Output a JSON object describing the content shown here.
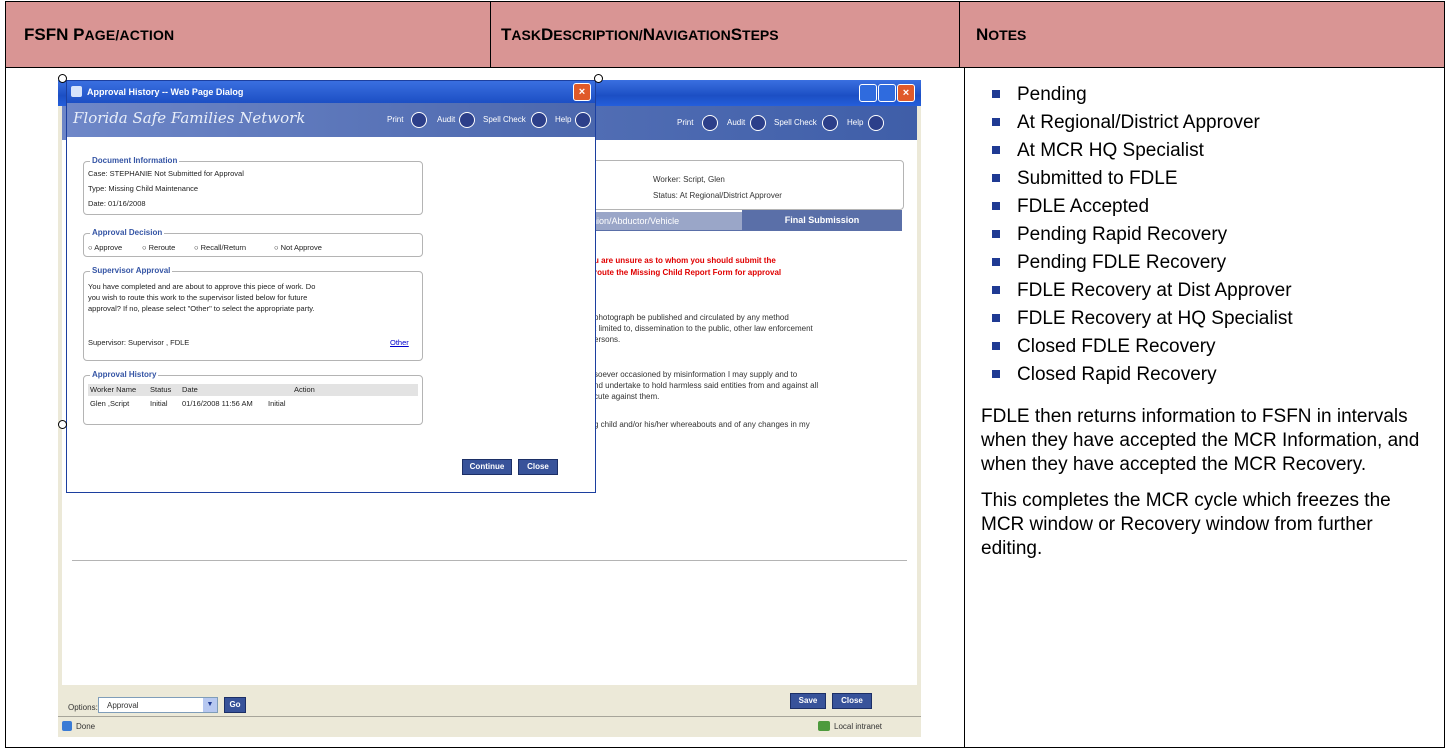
{
  "headers": {
    "col1_big": "FSFN P",
    "col1_small": "AGE/ACTION",
    "col2_a_big": "T",
    "col2_a_small": "ASK ",
    "col2_b_big": "D",
    "col2_b_small": "ESCRIPTION/",
    "col2_c_big": "N",
    "col2_c_small": "AVIGATION ",
    "col2_d_big": "S",
    "col2_d_small": "TEPS",
    "col3_big": "N",
    "col3_small": "OTES"
  },
  "notes": {
    "statuses": [
      "Pending",
      "At Regional/District Approver",
      "At MCR HQ Specialist",
      "Submitted to FDLE",
      "FDLE Accepted",
      "Pending Rapid Recovery",
      "Pending FDLE Recovery",
      "FDLE Recovery at Dist Approver",
      "FDLE Recovery at HQ Specialist",
      "Closed FDLE Recovery",
      "Closed Rapid Recovery"
    ],
    "paragraph1": "FDLE then returns information to FSFN in intervals when they have accepted the MCR Information, and when they have accepted the MCR Recovery.",
    "paragraph2": "This completes the MCR cycle which freezes the MCR window or Recovery window from further editing."
  },
  "screenshot": {
    "dialog_title": "Approval History -- Web Page Dialog",
    "banner": "Florida Safe Families Network",
    "toolbar": {
      "print": "Print",
      "audit": "Audit",
      "spell": "Spell Check",
      "help": "Help"
    },
    "doc_info": {
      "legend": "Document Information",
      "case": "Case: STEPHANIE Not Submitted for Approval",
      "type": "Type: Missing Child Maintenance",
      "date": "Date: 01/16/2008"
    },
    "decision": {
      "legend": "Approval Decision",
      "options": [
        "Approve",
        "Reroute",
        "Recall/Return",
        "Not Approve"
      ]
    },
    "supervisor": {
      "legend": "Supervisor Approval",
      "text1": "You have completed and are about to approve this piece of work. Do",
      "text2": "you wish to route this work to the supervisor listed below for future",
      "text3": "approval? If no, please select \"Other\" to select the appropriate party.",
      "supervisor": "Supervisor: Supervisor , FDLE",
      "other": "Other"
    },
    "history": {
      "legend": "Approval History",
      "cols": [
        "Worker Name",
        "Status",
        "Date",
        "Action"
      ],
      "row": [
        "Glen ,Script",
        "Initial",
        "01/16/2008 11:56 AM",
        "Initial"
      ]
    },
    "dialog_buttons": {
      "continue": "Continue",
      "close": "Close"
    },
    "bg": {
      "worker": "Worker:   Script, Glen",
      "status": "Status:   At Regional/District Approver",
      "tab_inactive": "panion/Abductor/Vehicle",
      "tab_active": "Final Submission",
      "red1": "u are unsure as to whom you should submit the",
      "red2": "route the Missing Child Report Form for approval",
      "p1a": "photograph be published and circulated by any method",
      "p1b": "t limited to, dissemination to the public, other law enforcement",
      "p1c": "ersons.",
      "p2a": "soever occasioned by misinformation I may supply and to",
      "p2b": "nd undertake to hold harmless said entities from and against all",
      "p2c": "cute against them.",
      "p3a": "g child and/or his/her whereabouts and of any changes in my",
      "options_label": "Options:",
      "options_value": "Approval",
      "go": "Go",
      "save": "Save",
      "close": "Close",
      "status_done": "Done",
      "status_zone": "Local intranet"
    }
  }
}
